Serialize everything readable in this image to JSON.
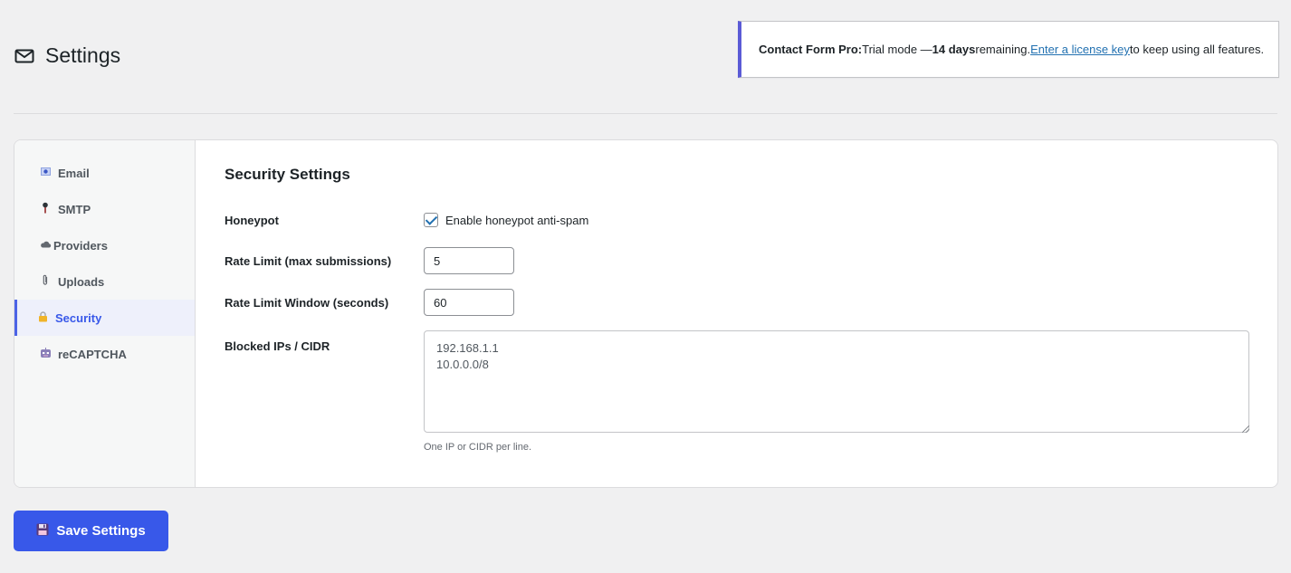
{
  "header": {
    "title": "Settings",
    "icon": "mail-icon"
  },
  "notice": {
    "product": "Contact Form Pro:",
    "text_before": " Trial mode — ",
    "days": "14 days",
    "text_middle": " remaining. ",
    "link": "Enter a license key",
    "text_after": " to keep using all features.",
    "accent_color": "#5b5bd6"
  },
  "sidebar": {
    "items": [
      {
        "label": "Email",
        "icon": "email-icon",
        "glyph": "●",
        "active": false
      },
      {
        "label": "SMTP",
        "icon": "pin-icon",
        "glyph": "📍",
        "active": false
      },
      {
        "label": "Providers",
        "icon": "cloud-icon",
        "glyph": "☁",
        "active": false
      },
      {
        "label": "Uploads",
        "icon": "paperclip-icon",
        "glyph": "📎",
        "active": false
      },
      {
        "label": "Security",
        "icon": "lock-icon",
        "glyph": "🔒",
        "active": true
      },
      {
        "label": "reCAPTCHA",
        "icon": "robot-icon",
        "glyph": "🤖",
        "active": false
      }
    ]
  },
  "security": {
    "title": "Security Settings",
    "honeypot_label": "Honeypot",
    "honeypot_checkbox_label": "Enable honeypot anti-spam",
    "honeypot_checked": true,
    "rate_limit_label": "Rate Limit (max submissions)",
    "rate_limit_value": "5",
    "rate_window_label": "Rate Limit Window (seconds)",
    "rate_window_value": "60",
    "blocked_label": "Blocked IPs / CIDR",
    "blocked_value": "192.168.1.1\n10.0.0.0/8",
    "blocked_hint": "One IP or CIDR per line."
  },
  "save_button": {
    "label": "Save Settings",
    "icon": "floppy-disk-icon",
    "color": "#3858e9"
  }
}
